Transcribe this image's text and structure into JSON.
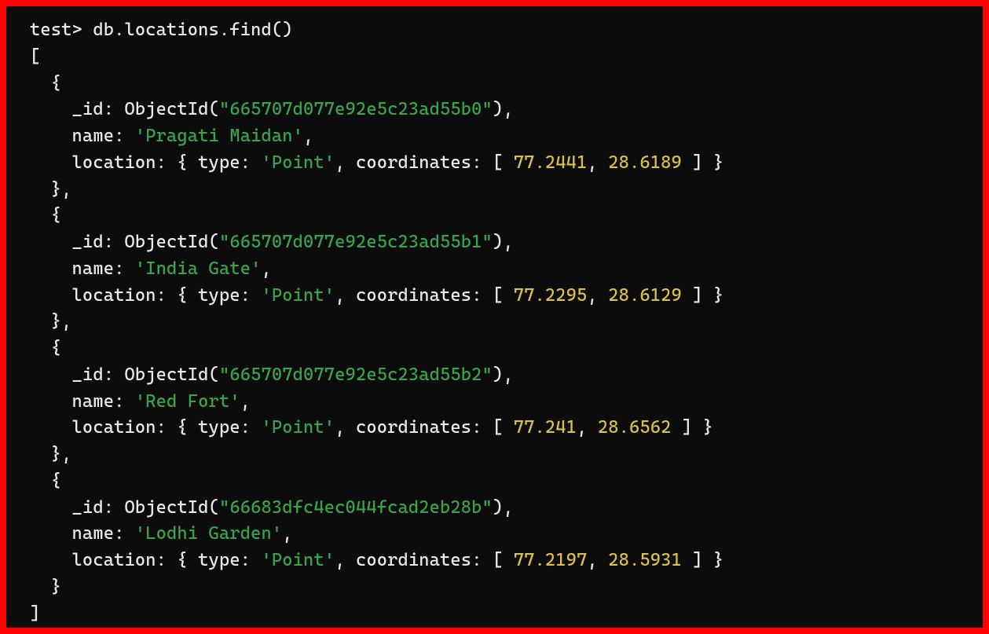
{
  "prompt": "test>",
  "command": "db.locations.find()",
  "func_name": "ObjectId",
  "keys": {
    "id": "_id",
    "name": "name",
    "location": "location",
    "type": "type",
    "coordinates": "coordinates"
  },
  "point_type": "'Point'",
  "records": [
    {
      "oid": "\"665707d077e92e5c23ad55b0\"",
      "name": "'Pragati Maidan'",
      "lon": "77.2441",
      "lat": "28.6189"
    },
    {
      "oid": "\"665707d077e92e5c23ad55b1\"",
      "name": "'India Gate'",
      "lon": "77.2295",
      "lat": "28.6129"
    },
    {
      "oid": "\"665707d077e92e5c23ad55b2\"",
      "name": "'Red Fort'",
      "lon": "77.241",
      "lat": "28.6562"
    },
    {
      "oid": "\"66683dfc4ec044fcad2eb28b\"",
      "name": "'Lodhi Garden'",
      "lon": "77.2197",
      "lat": "28.5931"
    }
  ]
}
